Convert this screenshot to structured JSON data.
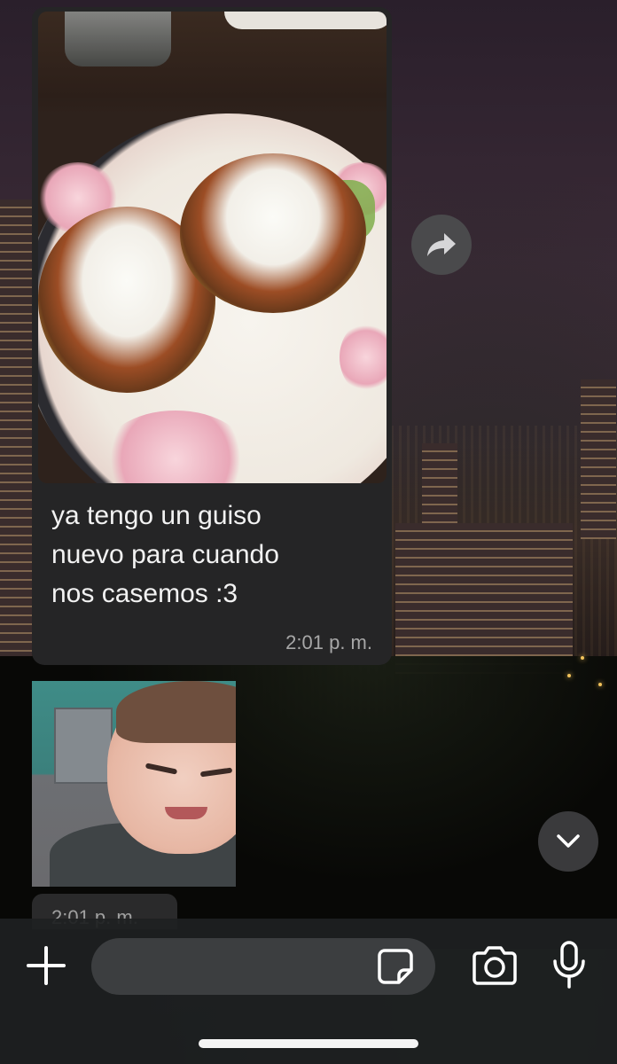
{
  "chat": {
    "food_message": {
      "text": "ya tengo un guiso\nnuevo para cuando\nnos casemos :3",
      "time": "2:01 p. m."
    },
    "baby_message": {
      "time": "2:01 p. m."
    }
  },
  "composer": {
    "placeholder": ""
  },
  "icons": {
    "forward": "forward-arrow-icon",
    "scroll_down": "chevron-down-icon",
    "attach": "plus-icon",
    "sticker": "sticker-icon",
    "camera": "camera-icon",
    "mic": "microphone-icon"
  },
  "colors": {
    "bubble": "#252526",
    "input_bar": "#1e2021",
    "icon": "#ffffff"
  }
}
